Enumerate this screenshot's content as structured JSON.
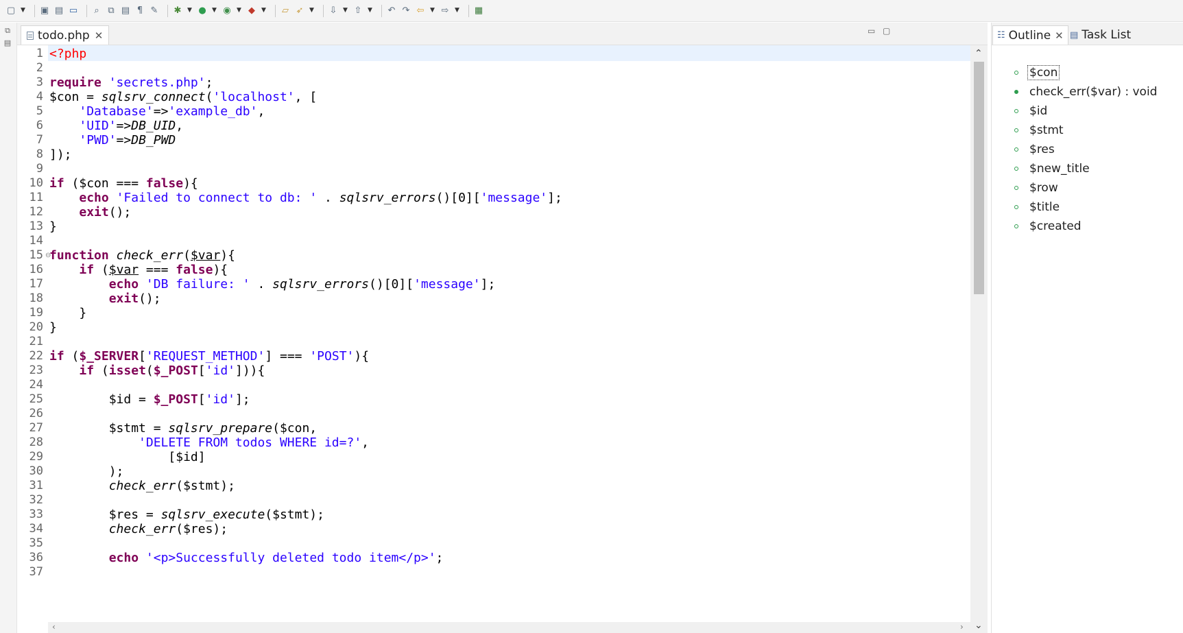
{
  "toolbar": {
    "icons": [
      "new-file-icon",
      "dropdown-arrow-icon",
      "save-icon",
      "save-all-icon",
      "terminal-icon",
      "search-icon",
      "copy-icon",
      "document-icon",
      "pilcrow-icon",
      "pen-icon",
      "debug-icon",
      "dropdown-arrow-icon",
      "run-icon",
      "dropdown-arrow-icon",
      "run-config-icon",
      "dropdown-arrow-icon",
      "external-tools-icon",
      "dropdown-arrow-icon",
      "open-folder-icon",
      "deploy-icon",
      "dropdown-arrow-icon",
      "next-annotation-icon",
      "dropdown-arrow-icon",
      "prev-annotation-icon",
      "dropdown-arrow-icon",
      "last-edit-icon",
      "forward-edit-icon",
      "back-icon",
      "dropdown-arrow-icon",
      "forward-icon",
      "dropdown-arrow-icon",
      "perspective-icon"
    ]
  },
  "editor": {
    "tab_label": "todo.php",
    "lines": [
      "<?php",
      "",
      "require 'secrets.php';",
      "$con = sqlsrv_connect('localhost', [",
      "    'Database'=>'example_db',",
      "    'UID'=>DB_UID,",
      "    'PWD'=>DB_PWD",
      "]);",
      "",
      "if ($con === false){",
      "    echo 'Failed to connect to db: ' . sqlsrv_errors()[0]['message'];",
      "    exit();",
      "}",
      "",
      "function check_err($var){",
      "    if ($var === false){",
      "        echo 'DB failure: ' . sqlsrv_errors()[0]['message'];",
      "        exit();",
      "    }",
      "}",
      "",
      "if ($_SERVER['REQUEST_METHOD'] === 'POST'){",
      "    if (isset($_POST['id'])){",
      "",
      "        $id = $_POST['id'];",
      "",
      "        $stmt = sqlsrv_prepare($con,",
      "            'DELETE FROM todos WHERE id=?',",
      "                [$id]",
      "        );",
      "        check_err($stmt);",
      "",
      "        $res = sqlsrv_execute($stmt);",
      "        check_err($res);",
      "",
      "        echo '<p>Successfully deleted todo item</p>';",
      ""
    ]
  },
  "panel": {
    "outline_tab": "Outline",
    "tasklist_tab": "Task List",
    "outline_items": [
      {
        "label": "$con",
        "kind": "variable",
        "selected": true
      },
      {
        "label": "check_err($var) : void",
        "kind": "function",
        "selected": false
      },
      {
        "label": "$id",
        "kind": "variable",
        "selected": false
      },
      {
        "label": "$stmt",
        "kind": "variable",
        "selected": false
      },
      {
        "label": "$res",
        "kind": "variable",
        "selected": false
      },
      {
        "label": "$new_title",
        "kind": "variable",
        "selected": false
      },
      {
        "label": "$row",
        "kind": "variable",
        "selected": false
      },
      {
        "label": "$title",
        "kind": "variable",
        "selected": false
      },
      {
        "label": "$created",
        "kind": "variable",
        "selected": false
      }
    ]
  },
  "colors": {
    "keyword": "#7f0055",
    "string": "#2a00ff",
    "php_tag": "#ff0000",
    "current_line": "#e8f2fe",
    "outline_dot": "#2e9d4f"
  }
}
